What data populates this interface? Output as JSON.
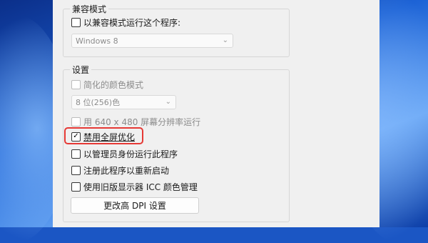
{
  "compat_group": {
    "title": "兼容模式",
    "run_compat_label": "以兼容模式运行这个程序:",
    "os_select_value": "Windows 8"
  },
  "settings_group": {
    "title": "设置",
    "reduced_color_label": "简化的颜色模式",
    "color_select_value": "8 位(256)色",
    "resolution_label": "用 640 x 480 屏幕分辨率运行",
    "disable_fullscreen_label": "禁用全屏优化",
    "run_as_admin_label": "以管理员身份运行此程序",
    "register_restart_label": "注册此程序以重新启动",
    "legacy_icc_label": "使用旧版显示器 ICC 颜色管理",
    "dpi_button_label": "更改高 DPI 设置"
  },
  "states": {
    "run_compat": "unchecked",
    "reduced_color": "disabled",
    "resolution_640": "disabled",
    "disable_fullscreen": "checked",
    "run_as_admin": "unchecked",
    "register_restart": "unchecked",
    "legacy_icc": "unchecked"
  },
  "colors": {
    "highlight_box": "#e53935",
    "dialog_bg": "#f0f0f0"
  }
}
